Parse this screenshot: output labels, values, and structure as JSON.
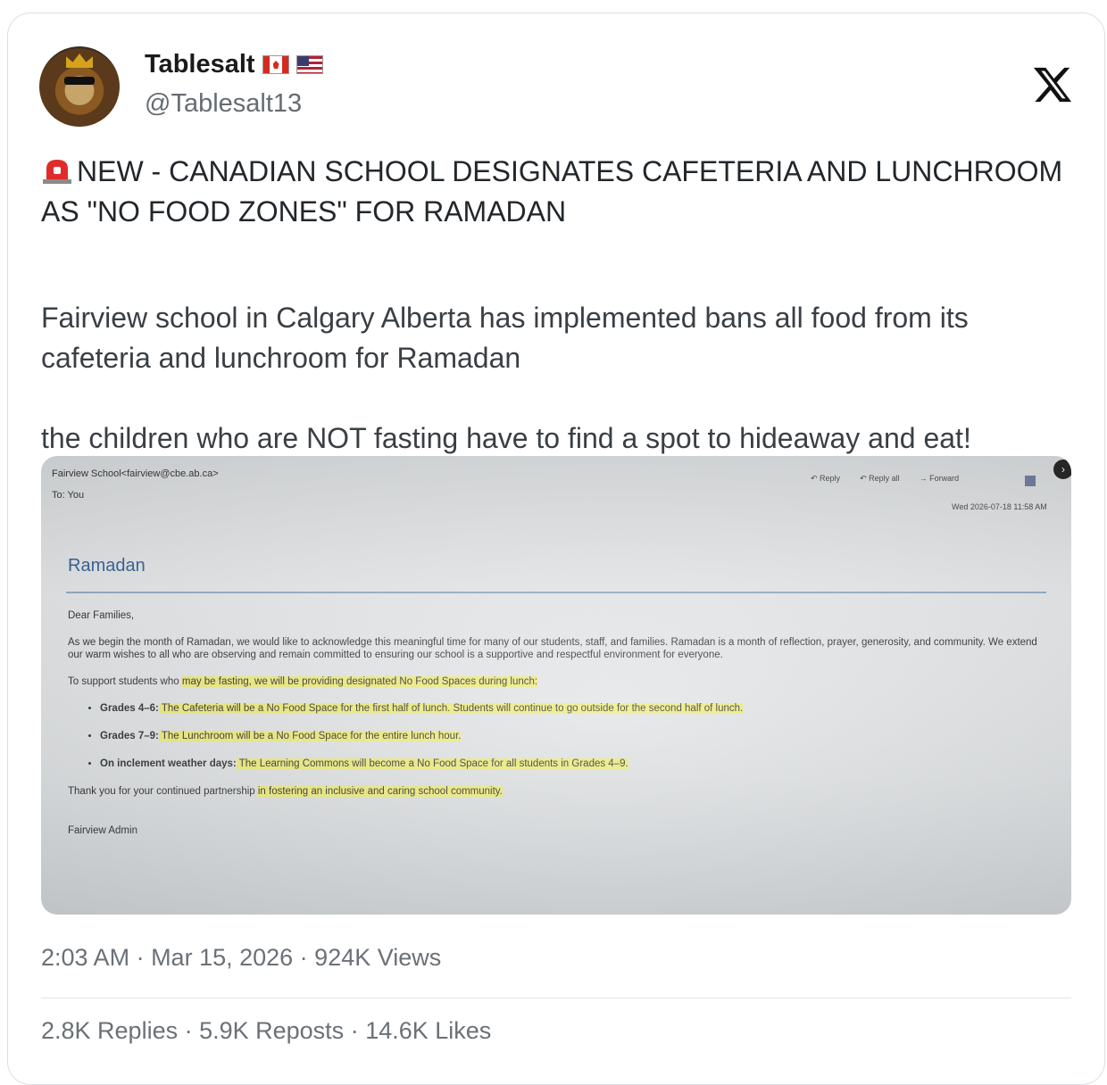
{
  "author": {
    "name": "Tablesalt",
    "handle": "@Tablesalt13",
    "flags": [
      "canada-flag",
      "usa-flag"
    ]
  },
  "tweet": {
    "headline": "NEW - CANADIAN SCHOOL DESIGNATES CAFETERIA AND LUNCHROOM AS \"NO FOOD ZONES\" FOR RAMADAN",
    "paragraph_2": "Fairview school in Calgary Alberta has implemented bans all food from its cafeteria and lunchroom for Ramadan",
    "paragraph_3": "the children who are NOT fasting have to find a spot to hideaway and eat!",
    "headline_icon": "siren-icon"
  },
  "email": {
    "from": "Fairview School<fairview@cbe.ab.ca>",
    "to": "To: You",
    "actions": [
      "Reply",
      "Reply all",
      "Forward"
    ],
    "date": "Wed 2026-07-18 11:58 AM",
    "subject": "Ramadan",
    "greeting": "Dear Families,",
    "intro": "As we begin the month of Ramadan, we would like to acknowledge this meaningful time for many of our students, staff, and families. Ramadan is a month of reflection, prayer, generosity, and community. We extend our warm wishes to all who are observing and remain committed to ensuring our school is a supportive and respectful environment for everyone.",
    "support_pre": "To support students who ",
    "support_hl": "may be fasting, we will be providing designated No Food Spaces during lunch:",
    "bullets": [
      {
        "label": "Grades 4–6:",
        "text": " The Cafeteria will be a No Food Space for the first half of lunch. Students will continue to go outside for the second half of lunch."
      },
      {
        "label": "Grades 7–9:",
        "text": " The Lunchroom will be a No Food Space for the entire lunch hour."
      },
      {
        "label": "On inclement weather days:",
        "text": " The Learning Commons will become a No Food Space for all students in Grades 4–9."
      }
    ],
    "closing_pre": "Thank you for your continued partnership ",
    "closing_hl": "in fostering an inclusive and caring school community.",
    "signature": "Fairview Admin"
  },
  "meta": {
    "time": "2:03 AM",
    "date": "Mar 15, 2026",
    "views": "924K Views",
    "separator": " · "
  },
  "stats": {
    "replies": "2.8K Replies",
    "reposts": "5.9K Reposts",
    "likes": "14.6K Likes"
  }
}
